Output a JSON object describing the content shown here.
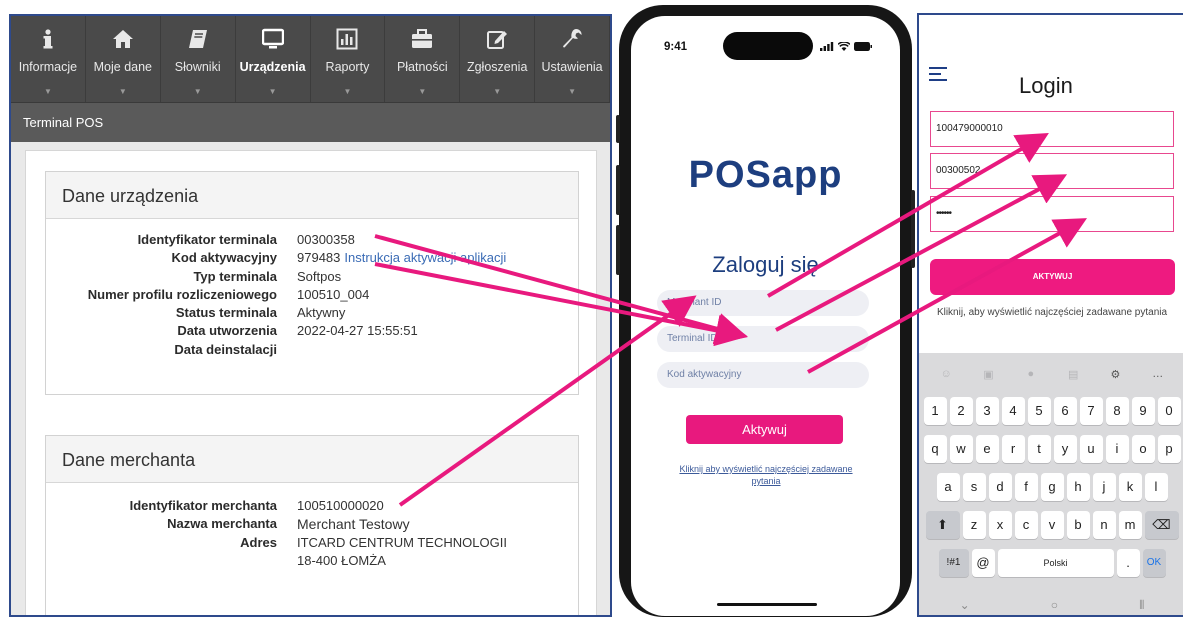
{
  "admin": {
    "nav": [
      {
        "label": "Informacje",
        "icon": "info-icon"
      },
      {
        "label": "Moje dane",
        "icon": "home-icon"
      },
      {
        "label": "Słowniki",
        "icon": "book-icon"
      },
      {
        "label": "Urządzenia",
        "icon": "monitor-icon"
      },
      {
        "label": "Raporty",
        "icon": "chart-icon"
      },
      {
        "label": "Płatności",
        "icon": "briefcase-icon"
      },
      {
        "label": "Zgłoszenia",
        "icon": "edit-icon"
      },
      {
        "label": "Ustawienia",
        "icon": "wrench-icon"
      }
    ],
    "breadcrumb": "Terminal POS",
    "device": {
      "title": "Dane urządzenia",
      "rows": [
        {
          "label": "Identyfikator terminala",
          "value": "00300358"
        },
        {
          "label": "Kod aktywacyjny",
          "value": "979483",
          "link": "Instrukcja aktywacji aplikacji"
        },
        {
          "label": "Typ terminala",
          "value": "Softpos"
        },
        {
          "label": "Numer profilu rozliczeniowego",
          "value": "100510_004"
        },
        {
          "label": "Status terminala",
          "value": "Aktywny"
        },
        {
          "label": "Data utworzenia",
          "value": "2022-04-27 15:55:51"
        },
        {
          "label": "Data deinstalacji",
          "value": ""
        }
      ]
    },
    "merchant": {
      "title": "Dane merchanta",
      "rows": [
        {
          "label": "Identyfikator merchanta",
          "value": "100510000020"
        },
        {
          "label": "Nazwa merchanta",
          "value": "Merchant Testowy"
        },
        {
          "label": "Adres",
          "value": "ITCARD CENTRUM TECHNOLOGII"
        },
        {
          "label": "",
          "value": "18-400 ŁOMŻA"
        }
      ]
    }
  },
  "phone": {
    "time": "9:41",
    "logo": "POSapp",
    "title": "Zaloguj się",
    "fields": {
      "merchant_placeholder": "Merchant ID",
      "terminal_placeholder": "Terminal ID",
      "code_placeholder": "Kod aktywacyjny"
    },
    "button": "Aktywuj",
    "faq": "Kliknij aby wyświetlić najczęściej zadawane pytania"
  },
  "android": {
    "title": "Login",
    "fields": [
      "100479000010",
      "00300502",
      "••••••"
    ],
    "button": "AKTYWUJ",
    "faq": "Kliknij, aby wyświetlić najczęściej zadawane pytania",
    "keyboard": {
      "row_numbers": [
        "1",
        "2",
        "3",
        "4",
        "5",
        "6",
        "7",
        "8",
        "9",
        "0"
      ],
      "row1": [
        "q",
        "w",
        "e",
        "r",
        "t",
        "y",
        "u",
        "i",
        "o",
        "p"
      ],
      "row2": [
        "a",
        "s",
        "d",
        "f",
        "g",
        "h",
        "j",
        "k",
        "l"
      ],
      "row3": [
        "z",
        "x",
        "c",
        "v",
        "b",
        "n",
        "m"
      ],
      "sym_key": "!#1",
      "at_key": "@",
      "space_label": "Polski",
      "dot_key": ".",
      "ok_key": "OK"
    }
  },
  "colors": {
    "accent_pink": "#e8197e",
    "brand_blue": "#1d3e7f",
    "nav_dark": "#4a4a4a"
  }
}
